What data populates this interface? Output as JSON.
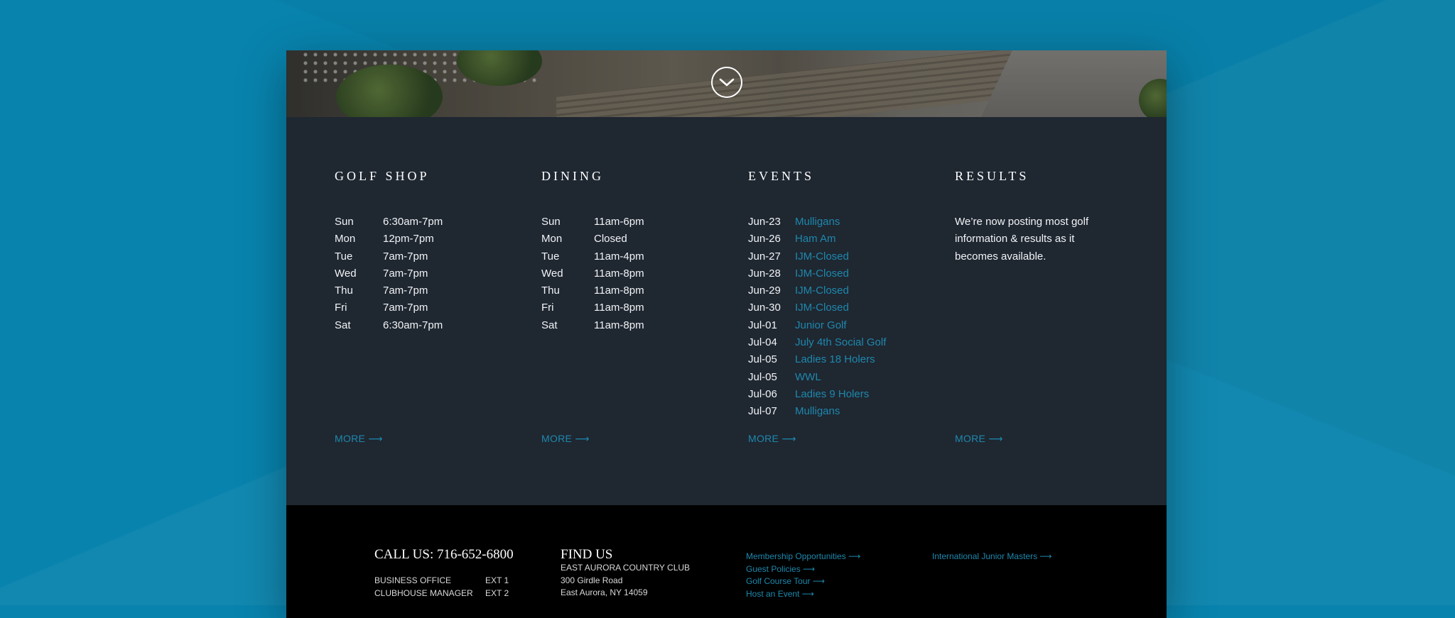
{
  "hero": {
    "scroll_icon": "chevron-down-circle-icon"
  },
  "golf_shop": {
    "title": "GOLF SHOP",
    "hours": [
      {
        "day": "Sun",
        "time": "6:30am-7pm"
      },
      {
        "day": "Mon",
        "time": "12pm-7pm"
      },
      {
        "day": "Tue",
        "time": "7am-7pm"
      },
      {
        "day": "Wed",
        "time": "7am-7pm"
      },
      {
        "day": "Thu",
        "time": "7am-7pm"
      },
      {
        "day": "Fri",
        "time": "7am-7pm"
      },
      {
        "day": "Sat",
        "time": "6:30am-7pm"
      }
    ],
    "more": "MORE ⟶"
  },
  "dining": {
    "title": "DINING",
    "hours": [
      {
        "day": "Sun",
        "time": "11am-6pm"
      },
      {
        "day": "Mon",
        "time": "Closed"
      },
      {
        "day": "Tue",
        "time": "11am-4pm"
      },
      {
        "day": "Wed",
        "time": "11am-8pm"
      },
      {
        "day": "Thu",
        "time": "11am-8pm"
      },
      {
        "day": "Fri",
        "time": "11am-8pm"
      },
      {
        "day": "Sat",
        "time": "11am-8pm"
      }
    ],
    "more": "MORE ⟶"
  },
  "events": {
    "title": "EVENTS",
    "items": [
      {
        "date": "Jun-23",
        "name": "Mulligans"
      },
      {
        "date": "Jun-26",
        "name": "Ham Am"
      },
      {
        "date": "Jun-27",
        "name": "IJM-Closed"
      },
      {
        "date": "Jun-28",
        "name": "IJM-Closed"
      },
      {
        "date": "Jun-29",
        "name": "IJM-Closed"
      },
      {
        "date": "Jun-30",
        "name": "IJM-Closed"
      },
      {
        "date": "Jul-01",
        "name": "Junior Golf"
      },
      {
        "date": "Jul-04",
        "name": "July 4th Social Golf"
      },
      {
        "date": "Jul-05",
        "name": "Ladies 18 Holers"
      },
      {
        "date": "Jul-05",
        "name": "WWL"
      },
      {
        "date": "Jul-06",
        "name": "Ladies 9 Holers"
      },
      {
        "date": "Jul-07",
        "name": "Mulligans"
      }
    ],
    "more": "MORE ⟶"
  },
  "results": {
    "title": "RESULTS",
    "text": "We’re now posting most golf information & results as it becomes available.",
    "more": "MORE ⟶"
  },
  "footer": {
    "call": {
      "title": "CALL US: 716-652-6800",
      "lines": [
        {
          "label": "BUSINESS OFFICE",
          "ext": "EXT 1"
        },
        {
          "label": "CLUBHOUSE MANAGER",
          "ext": "EXT 2"
        }
      ]
    },
    "find": {
      "title": "FIND US",
      "lines": [
        "EAST AURORA COUNTRY CLUB",
        "300 Girdle Road",
        "East Aurora, NY 14059"
      ]
    },
    "links_a": [
      "Membership Opportunities ⟶",
      "Guest Policies ⟶",
      "Golf Course Tour ⟶",
      "Host an Event ⟶"
    ],
    "links_b": [
      "International Junior Masters ⟶"
    ]
  },
  "colors": {
    "accent": "#1e88ad",
    "panel": "#1f2731",
    "background": "#0883ad",
    "footer": "#000000"
  }
}
